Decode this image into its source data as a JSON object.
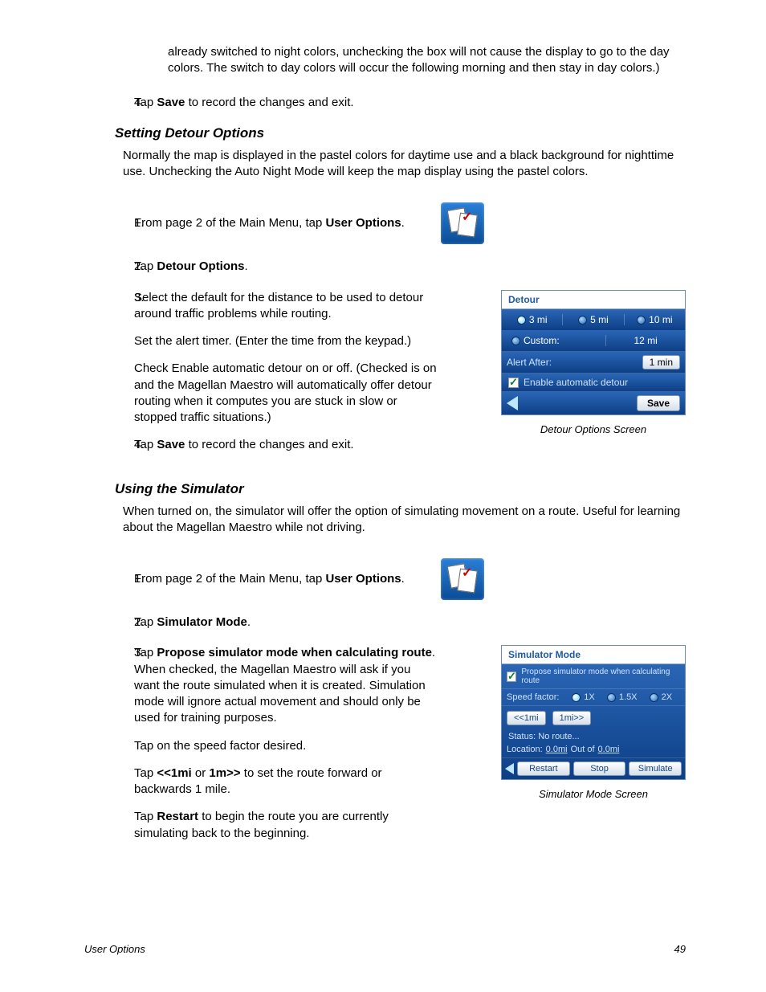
{
  "continued_para": "already switched to night colors, unchecking the box will not cause the display to go to the day colors.  The switch to day colors will occur the following morning and then stay in day colors.)",
  "top_step4_num": "4.",
  "top_step4_a": "Tap ",
  "top_step4_b": "Save",
  "top_step4_c": " to record the changes and exit.",
  "sec1_heading": "Setting Detour Options",
  "sec1_intro": "Normally the map is displayed in the pastel colors for daytime use and a black background for nighttime use.  Unchecking the Auto Night Mode will keep the map display using the pastel colors.",
  "s1_1_num": "1.",
  "s1_1_a": "From page 2 of the Main Menu, tap ",
  "s1_1_b": "User Options",
  "s1_1_c": ".",
  "s1_2_num": "2.",
  "s1_2_a": "Tap ",
  "s1_2_b": "Detour Options",
  "s1_2_c": ".",
  "s1_3_num": "3.",
  "s1_3_p1": "Select the default for the distance to be used to detour around traffic problems while routing.",
  "s1_3_p2": "Set the alert timer.  (Enter the time from the keypad.)",
  "s1_3_p3": "Check Enable automatic detour on or off.  (Checked is on and the Magellan Maestro will automatically offer detour routing when it computes you are stuck in slow or stopped traffic situations.)",
  "s1_4_num": "4.",
  "s1_4_a": "Tap ",
  "s1_4_b": "Save",
  "s1_4_c": " to record the changes and exit.",
  "detour_caption": "Detour Options Screen",
  "detour": {
    "title": "Detour",
    "opt1": "3 mi",
    "opt2": "5 mi",
    "opt3": "10 mi",
    "custom_label": "Custom:",
    "custom_val": "12 mi",
    "alert_label": "Alert After:",
    "alert_val": "1 min",
    "enable_label": "Enable automatic detour",
    "save": "Save"
  },
  "sec2_heading": "Using the Simulator",
  "sec2_intro": "When turned on, the simulator will offer the option of simulating movement on a route.  Useful for learning about the Magellan Maestro while not driving.",
  "s2_1_num": "1.",
  "s2_1_a": "From page 2 of the Main Menu, tap ",
  "s2_1_b": "User Options",
  "s2_1_c": ".",
  "s2_2_num": "2.",
  "s2_2_a": "Tap ",
  "s2_2_b": "Simulator Mode",
  "s2_2_c": ".",
  "s2_3_num": "3.",
  "s2_3_a": "Tap ",
  "s2_3_b": "Propose simulator mode when calculating route",
  "s2_3_c": ".  When checked, the Magellan Maestro will ask if you want the route simulated when it is created.  Simulation mode will ignore actual movement and should only be used for training purposes.",
  "s2_3_p2": "Tap on the speed factor desired.",
  "s2_3_p3a": "Tap ",
  "s2_3_p3b": "<<1mi",
  "s2_3_p3c": " or ",
  "s2_3_p3d": "1m>>",
  "s2_3_p3e": " to set the route forward or backwards 1 mile.",
  "s2_3_p4a": "Tap ",
  "s2_3_p4b": "Restart",
  "s2_3_p4c": " to begin the route you are currently simulating back to the beginning.",
  "sim_caption": "Simulator Mode Screen",
  "sim": {
    "title": "Simulator Mode",
    "propose": "Propose simulator mode when calculating route",
    "speed_label": "Speed factor:",
    "sp1": "1X",
    "sp2": "1.5X",
    "sp3": "2X",
    "back1": "<<1mi",
    "fwd1": "1mi>>",
    "status": "Status: No route...",
    "loc_label": "Location:",
    "loc_a": "0.0mi",
    "loc_mid": "Out of",
    "loc_b": "0.0mi",
    "restart": "Restart",
    "stop": "Stop",
    "simulate": "Simulate"
  },
  "footer_left": "User Options",
  "footer_right": "49"
}
